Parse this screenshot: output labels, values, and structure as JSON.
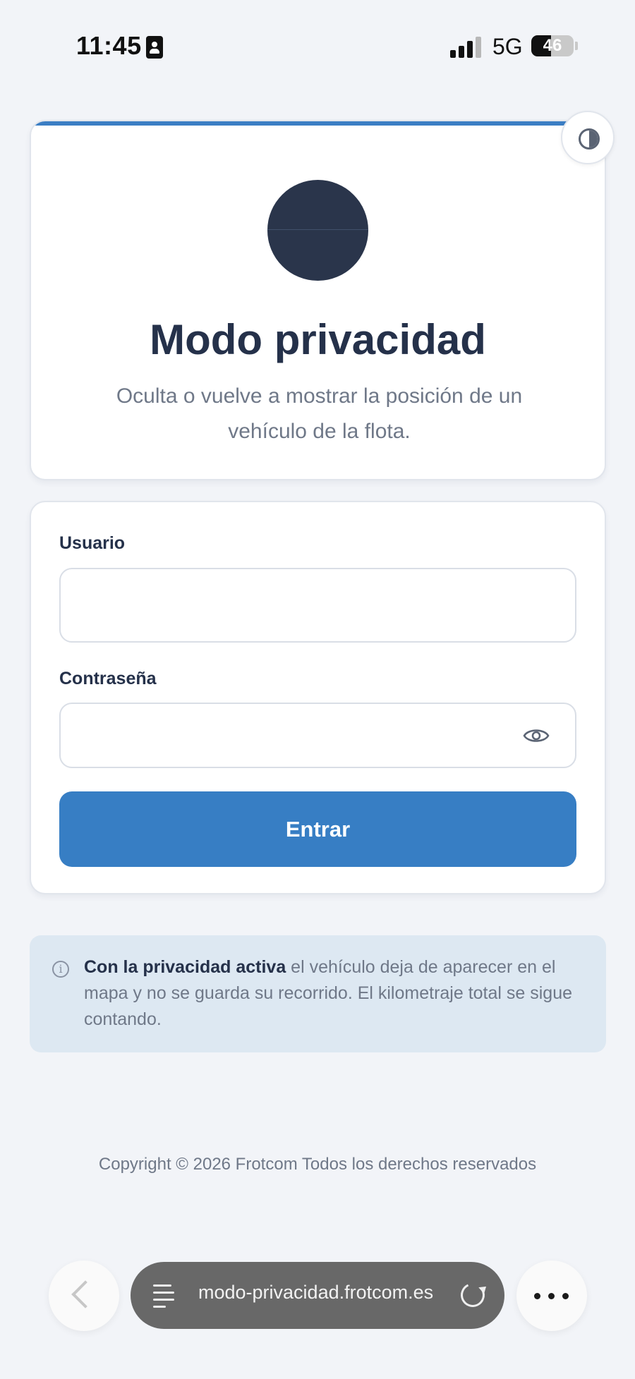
{
  "status_bar": {
    "time": "11:45",
    "network": "5G",
    "battery": "46",
    "battery_level": 0.46
  },
  "header": {
    "title": "Modo privacidad",
    "subtitle": "Oculta o vuelve a mostrar la posición de un vehículo de la flota."
  },
  "form": {
    "username_label": "Usuario",
    "username_value": "",
    "password_label": "Contraseña",
    "password_value": "",
    "submit_label": "Entrar"
  },
  "info": {
    "bold_text": "Con la privacidad activa",
    "text": " el vehículo deja de aparecer en el mapa y no se guarda su recorrido. El kilometraje total se sigue contando."
  },
  "footer": {
    "copyright": "Copyright © 2026 Frotcom Todos los derechos reservados"
  },
  "browser": {
    "url": "modo-privacidad.frotcom.es"
  },
  "colors": {
    "accent": "#377ec4",
    "text_dark": "#25314a",
    "text_muted": "#6f7888",
    "info_bg": "#dde8f2"
  }
}
